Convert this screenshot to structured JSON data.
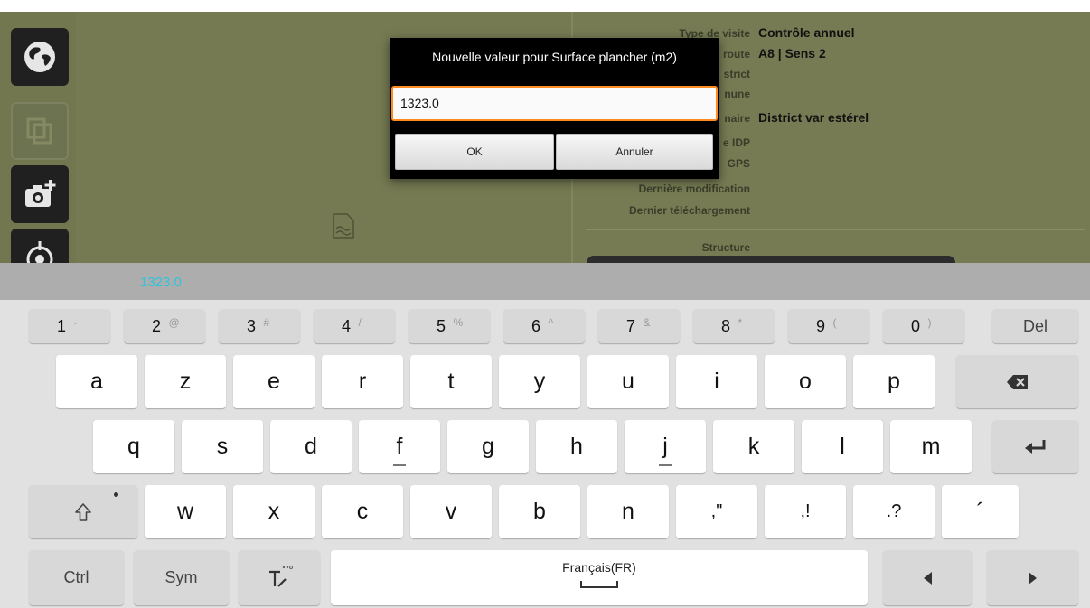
{
  "app": {
    "info_rows": [
      {
        "label": "Type de visite",
        "value": "Contrôle annuel"
      },
      {
        "label": "route",
        "value": "A8 | Sens 2"
      },
      {
        "label": "strict",
        "value": ""
      },
      {
        "label": "nune",
        "value": ""
      },
      {
        "label": "naire",
        "value": "District var estérel"
      },
      {
        "label": "e IDP",
        "value": ""
      },
      {
        "label": "GPS",
        "value": ""
      },
      {
        "label": "Dernière modification",
        "value": ""
      },
      {
        "label": "Dernier téléchargement",
        "value": ""
      }
    ],
    "structure_label": "Structure",
    "rail_icons": [
      "globe-icon",
      "copy-icon",
      "add-photo-icon",
      "target-icon"
    ]
  },
  "dialog": {
    "title": "Nouvelle valeur pour Surface plancher (m2)",
    "input_value": "1323.0",
    "ok_label": "OK",
    "cancel_label": "Annuler"
  },
  "keyboard": {
    "preview_text": "1323.0",
    "row_numbers": [
      {
        "main": "1",
        "sub": "-"
      },
      {
        "main": "2",
        "sub": "@"
      },
      {
        "main": "3",
        "sub": "#"
      },
      {
        "main": "4",
        "sub": "/"
      },
      {
        "main": "5",
        "sub": "%"
      },
      {
        "main": "6",
        "sub": "^"
      },
      {
        "main": "7",
        "sub": "&"
      },
      {
        "main": "8",
        "sub": "*"
      },
      {
        "main": "9",
        "sub": "("
      },
      {
        "main": "0",
        "sub": ")"
      }
    ],
    "del_label": "Del",
    "row1": [
      "a",
      "z",
      "e",
      "r",
      "t",
      "y",
      "u",
      "i",
      "o",
      "p"
    ],
    "row2": [
      "q",
      "s",
      "d",
      "f",
      "g",
      "h",
      "j",
      "k",
      "l",
      "m"
    ],
    "row3": [
      "w",
      "x",
      "c",
      "v",
      "b",
      "n",
      ",\"",
      ",!",
      ".?",
      "´"
    ],
    "ctrl_label": "Ctrl",
    "sym_label": "Sym",
    "space_label": "Français(FR)",
    "accent_color": "#ff8a1f",
    "preview_color": "#2ec4de"
  }
}
